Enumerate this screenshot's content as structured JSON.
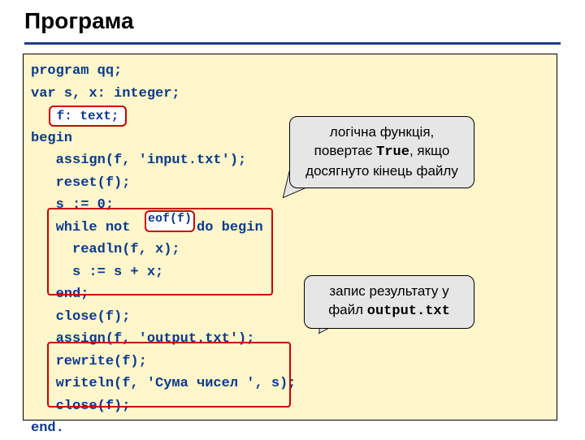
{
  "title": "Програма",
  "code": "program qq;\nvar s, x: integer;\n\nbegin\n   assign(f, 'input.txt');\n   reset(f);\n   s := 0;\n   while not        do begin\n     readln(f, x);\n     s := s + x;\n   end;\n   close(f);\n   assign(f, 'output.txt');\n   rewrite(f);\n   writeln(f, 'Сума чисел ', s);\n   close(f);\nend.",
  "hl_ftext": "f: text;",
  "hl_eof": "eof(f)",
  "callout1": {
    "line1": "логічна функція,",
    "line2a": "повертає ",
    "line2b": "True",
    "line2c": ", якщо",
    "line3": "досягнуто кінець файлу"
  },
  "callout2": {
    "line1": "запис результату у",
    "line2a": "файл ",
    "line2b": "output.txt"
  }
}
